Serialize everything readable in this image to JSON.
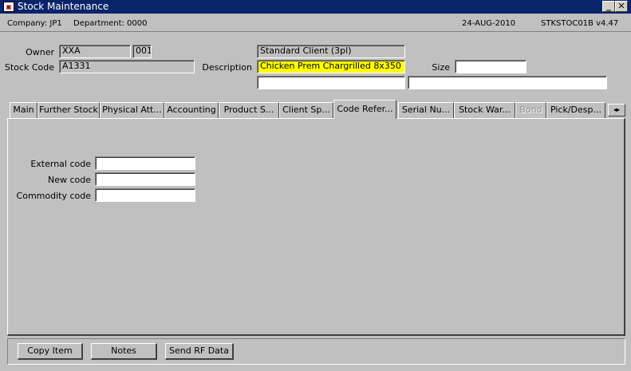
{
  "window": {
    "title": "Stock Maintenance",
    "icon": "application-icon",
    "minimize_label": "_",
    "close_label": "✕"
  },
  "infobar": {
    "company": "Company:  JP1",
    "department": "Department:  0000",
    "date": "24-AUG-2010",
    "program": "STKSTOC01B  v4.47"
  },
  "header": {
    "owner_label": "Owner",
    "owner_value": "XXA",
    "owner_code": "001",
    "stock_code_label": "Stock Code",
    "stock_code_value": "A1331",
    "client_type": "Standard Client (3pl)",
    "description_label": "Description",
    "description_value": "Chicken Prem Chargrilled 8x350",
    "size_label": "Size",
    "size_value": "",
    "extra_field_1": "",
    "extra_field_2": ""
  },
  "tabs": [
    {
      "label": "Main"
    },
    {
      "label": "Further Stock"
    },
    {
      "label": "Physical Att..."
    },
    {
      "label": "Accounting"
    },
    {
      "label": "Product S..."
    },
    {
      "label": "Client Sp..."
    },
    {
      "label": "Code Refer..."
    },
    {
      "label": "Serial Nu..."
    },
    {
      "label": "Stock War..."
    },
    {
      "label": "Bond"
    },
    {
      "label": "Pick/Desp..."
    }
  ],
  "tab_scroll_label": "◂▸",
  "code_reference": {
    "external_code_label": "External code",
    "external_code_value": "",
    "new_code_label": "New code",
    "new_code_value": "",
    "commodity_code_label": "Commodity code",
    "commodity_code_value": ""
  },
  "buttons": {
    "copy_item": "Copy Item",
    "notes": "Notes",
    "send_rf_data": "Send RF Data"
  },
  "colors": {
    "titlebar": "#0a246a",
    "description_highlight": "#ffff00",
    "window_bg": "#c0c0c0"
  }
}
